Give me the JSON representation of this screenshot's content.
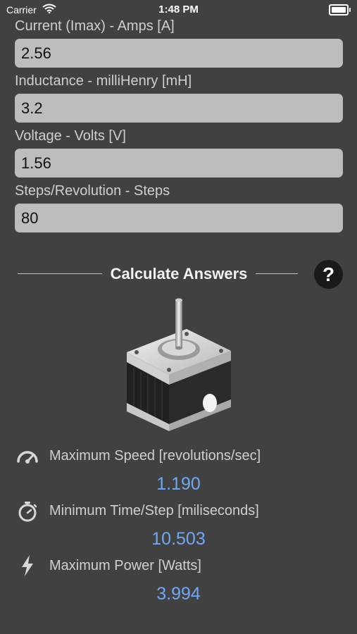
{
  "status_bar": {
    "carrier": "Carrier",
    "time": "1:48 PM",
    "battery_level": 1.0
  },
  "fields": [
    {
      "label": "Current (Imax) - Amps [A]",
      "value": "2.56"
    },
    {
      "label": "Inductance - milliHenry [mH]",
      "value": "3.2"
    },
    {
      "label": "Voltage - Volts [V]",
      "value": "1.56"
    },
    {
      "label": "Steps/Revolution - Steps",
      "value": "80"
    }
  ],
  "calculate_label": "Calculate Answers",
  "help_label": "?",
  "results": [
    {
      "icon": "speedometer-icon",
      "label": "Maximum Speed [revolutions/sec]",
      "value": "1.190"
    },
    {
      "icon": "stopwatch-icon",
      "label": "Minimum Time/Step [miliseconds]",
      "value": "10.503"
    },
    {
      "icon": "lightning-bolt-icon",
      "label": "Maximum Power [Watts]",
      "value": "3.994"
    }
  ],
  "colors": {
    "background": "#414141",
    "input_bg": "#bdbdbd",
    "result_value": "#6fa8f5",
    "label": "#cfcfcf"
  }
}
